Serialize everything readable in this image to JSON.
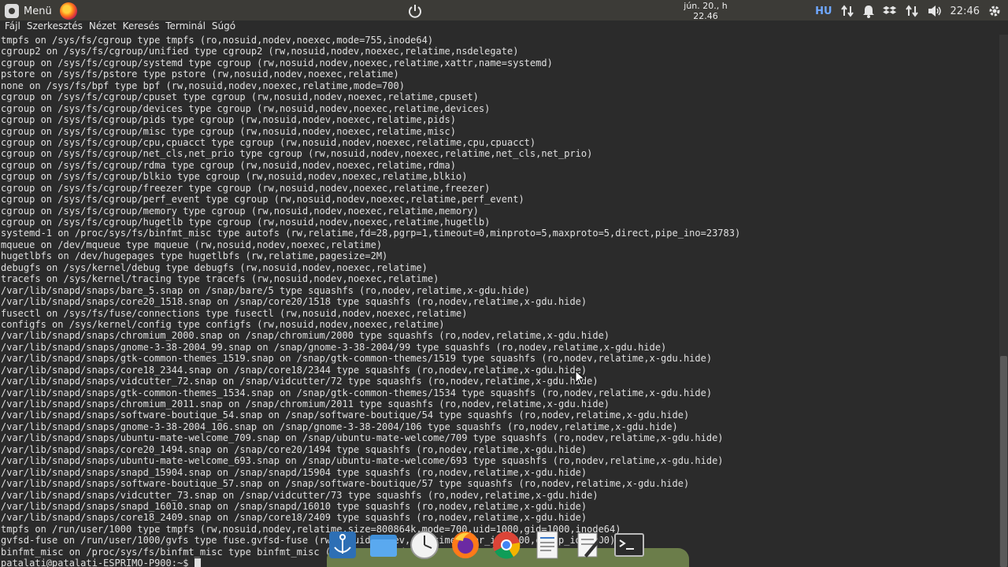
{
  "panel": {
    "menu_label": "Menü",
    "date": "jún. 20., h",
    "time_center": "22.46",
    "keyboard_layout": "HU",
    "time_right": "22:46"
  },
  "terminal": {
    "menu_items": [
      "Fájl",
      "Szerkesztés",
      "Nézet",
      "Keresés",
      "Terminál",
      "Súgó"
    ],
    "lines": [
      "tmpfs on /sys/fs/cgroup type tmpfs (ro,nosuid,nodev,noexec,mode=755,inode64)",
      "cgroup2 on /sys/fs/cgroup/unified type cgroup2 (rw,nosuid,nodev,noexec,relatime,nsdelegate)",
      "cgroup on /sys/fs/cgroup/systemd type cgroup (rw,nosuid,nodev,noexec,relatime,xattr,name=systemd)",
      "pstore on /sys/fs/pstore type pstore (rw,nosuid,nodev,noexec,relatime)",
      "none on /sys/fs/bpf type bpf (rw,nosuid,nodev,noexec,relatime,mode=700)",
      "cgroup on /sys/fs/cgroup/cpuset type cgroup (rw,nosuid,nodev,noexec,relatime,cpuset)",
      "cgroup on /sys/fs/cgroup/devices type cgroup (rw,nosuid,nodev,noexec,relatime,devices)",
      "cgroup on /sys/fs/cgroup/pids type cgroup (rw,nosuid,nodev,noexec,relatime,pids)",
      "cgroup on /sys/fs/cgroup/misc type cgroup (rw,nosuid,nodev,noexec,relatime,misc)",
      "cgroup on /sys/fs/cgroup/cpu,cpuacct type cgroup (rw,nosuid,nodev,noexec,relatime,cpu,cpuacct)",
      "cgroup on /sys/fs/cgroup/net_cls,net_prio type cgroup (rw,nosuid,nodev,noexec,relatime,net_cls,net_prio)",
      "cgroup on /sys/fs/cgroup/rdma type cgroup (rw,nosuid,nodev,noexec,relatime,rdma)",
      "cgroup on /sys/fs/cgroup/blkio type cgroup (rw,nosuid,nodev,noexec,relatime,blkio)",
      "cgroup on /sys/fs/cgroup/freezer type cgroup (rw,nosuid,nodev,noexec,relatime,freezer)",
      "cgroup on /sys/fs/cgroup/perf_event type cgroup (rw,nosuid,nodev,noexec,relatime,perf_event)",
      "cgroup on /sys/fs/cgroup/memory type cgroup (rw,nosuid,nodev,noexec,relatime,memory)",
      "cgroup on /sys/fs/cgroup/hugetlb type cgroup (rw,nosuid,nodev,noexec,relatime,hugetlb)",
      "systemd-1 on /proc/sys/fs/binfmt_misc type autofs (rw,relatime,fd=28,pgrp=1,timeout=0,minproto=5,maxproto=5,direct,pipe_ino=23783)",
      "mqueue on /dev/mqueue type mqueue (rw,nosuid,nodev,noexec,relatime)",
      "hugetlbfs on /dev/hugepages type hugetlbfs (rw,relatime,pagesize=2M)",
      "debugfs on /sys/kernel/debug type debugfs (rw,nosuid,nodev,noexec,relatime)",
      "tracefs on /sys/kernel/tracing type tracefs (rw,nosuid,nodev,noexec,relatime)",
      "/var/lib/snapd/snaps/bare_5.snap on /snap/bare/5 type squashfs (ro,nodev,relatime,x-gdu.hide)",
      "/var/lib/snapd/snaps/core20_1518.snap on /snap/core20/1518 type squashfs (ro,nodev,relatime,x-gdu.hide)",
      "fusectl on /sys/fs/fuse/connections type fusectl (rw,nosuid,nodev,noexec,relatime)",
      "configfs on /sys/kernel/config type configfs (rw,nosuid,nodev,noexec,relatime)",
      "/var/lib/snapd/snaps/chromium_2000.snap on /snap/chromium/2000 type squashfs (ro,nodev,relatime,x-gdu.hide)",
      "/var/lib/snapd/snaps/gnome-3-38-2004_99.snap on /snap/gnome-3-38-2004/99 type squashfs (ro,nodev,relatime,x-gdu.hide)",
      "/var/lib/snapd/snaps/gtk-common-themes_1519.snap on /snap/gtk-common-themes/1519 type squashfs (ro,nodev,relatime,x-gdu.hide)",
      "/var/lib/snapd/snaps/core18_2344.snap on /snap/core18/2344 type squashfs (ro,nodev,relatime,x-gdu.hide)",
      "/var/lib/snapd/snaps/vidcutter_72.snap on /snap/vidcutter/72 type squashfs (ro,nodev,relatime,x-gdu.hide)",
      "/var/lib/snapd/snaps/gtk-common-themes_1534.snap on /snap/gtk-common-themes/1534 type squashfs (ro,nodev,relatime,x-gdu.hide)",
      "/var/lib/snapd/snaps/chromium_2011.snap on /snap/chromium/2011 type squashfs (ro,nodev,relatime,x-gdu.hide)",
      "/var/lib/snapd/snaps/software-boutique_54.snap on /snap/software-boutique/54 type squashfs (ro,nodev,relatime,x-gdu.hide)",
      "/var/lib/snapd/snaps/gnome-3-38-2004_106.snap on /snap/gnome-3-38-2004/106 type squashfs (ro,nodev,relatime,x-gdu.hide)",
      "/var/lib/snapd/snaps/ubuntu-mate-welcome_709.snap on /snap/ubuntu-mate-welcome/709 type squashfs (ro,nodev,relatime,x-gdu.hide)",
      "/var/lib/snapd/snaps/core20_1494.snap on /snap/core20/1494 type squashfs (ro,nodev,relatime,x-gdu.hide)",
      "/var/lib/snapd/snaps/ubuntu-mate-welcome_693.snap on /snap/ubuntu-mate-welcome/693 type squashfs (ro,nodev,relatime,x-gdu.hide)",
      "/var/lib/snapd/snaps/snapd_15904.snap on /snap/snapd/15904 type squashfs (ro,nodev,relatime,x-gdu.hide)",
      "/var/lib/snapd/snaps/software-boutique_57.snap on /snap/software-boutique/57 type squashfs (ro,nodev,relatime,x-gdu.hide)",
      "/var/lib/snapd/snaps/vidcutter_73.snap on /snap/vidcutter/73 type squashfs (ro,nodev,relatime,x-gdu.hide)",
      "/var/lib/snapd/snaps/snapd_16010.snap on /snap/snapd/16010 type squashfs (ro,nodev,relatime,x-gdu.hide)",
      "/var/lib/snapd/snaps/core18_2409.snap on /snap/core18/2409 type squashfs (ro,nodev,relatime,x-gdu.hide)",
      "tmpfs on /run/user/1000 type tmpfs (rw,nosuid,nodev,relatime,size=800864k,mode=700,uid=1000,gid=1000,inode64)",
      "gvfsd-fuse on /run/user/1000/gvfs type fuse.gvfsd-fuse (rw,nosuid,nodev,relatime,user_id=1000,group_id=1000)",
      "binfmt_misc on /proc/sys/fs/binfmt_misc type binfmt_misc (rw,nosuid,nodev,noexec,relatime)"
    ],
    "prompt": "patalati@patalati-ESPRIMO-P900:~$ "
  },
  "dock": {
    "icons": [
      "anchor-icon",
      "files-icon",
      "clock-icon",
      "firefox-icon",
      "chrome-icon",
      "text-editor-icon",
      "pen-icon",
      "terminal-icon"
    ]
  }
}
